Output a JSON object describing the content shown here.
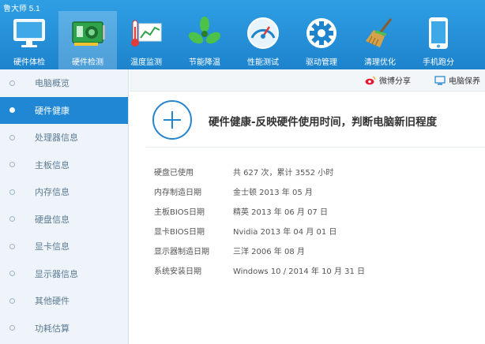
{
  "app": {
    "title": "鲁大师 5.1"
  },
  "toolbar": {
    "items": [
      {
        "label": "硬件体检",
        "icon": "monitor-icon"
      },
      {
        "label": "硬件检测",
        "icon": "graphics-card-icon"
      },
      {
        "label": "温度监测",
        "icon": "thermometer-chart-icon"
      },
      {
        "label": "节能降温",
        "icon": "fan-icon"
      },
      {
        "label": "性能测试",
        "icon": "speedometer-icon"
      },
      {
        "label": "驱动管理",
        "icon": "gear-icon"
      },
      {
        "label": "清理优化",
        "icon": "broom-icon"
      },
      {
        "label": "手机跑分",
        "icon": "phone-icon"
      }
    ],
    "active_index": 1
  },
  "sidebar": {
    "items": [
      {
        "label": "电脑概览"
      },
      {
        "label": "硬件健康"
      },
      {
        "label": "处理器信息"
      },
      {
        "label": "主板信息"
      },
      {
        "label": "内存信息"
      },
      {
        "label": "硬盘信息"
      },
      {
        "label": "显卡信息"
      },
      {
        "label": "显示器信息"
      },
      {
        "label": "其他硬件"
      },
      {
        "label": "功耗估算"
      }
    ],
    "active_index": 1
  },
  "actions": {
    "weibo_share": "微博分享",
    "pc_save": "电脑保养"
  },
  "main": {
    "title": "硬件健康-反映硬件使用时间，判断电脑新旧程度",
    "rows": [
      {
        "key": "硬盘已使用",
        "value": "共 627 次，累计 3552 小时"
      },
      {
        "key": "内存制造日期",
        "value": "金士顿 2013 年 05 月"
      },
      {
        "key": "主板BIOS日期",
        "value": "精英 2013 年 06 月 07 日"
      },
      {
        "key": "显卡BIOS日期",
        "value": "Nvidia 2013 年 04 月 01 日"
      },
      {
        "key": "显示器制造日期",
        "value": "三洋 2006 年 08 月"
      },
      {
        "key": "系统安装日期",
        "value": "Windows 10 / 2014 年 10 月 31 日"
      }
    ]
  }
}
